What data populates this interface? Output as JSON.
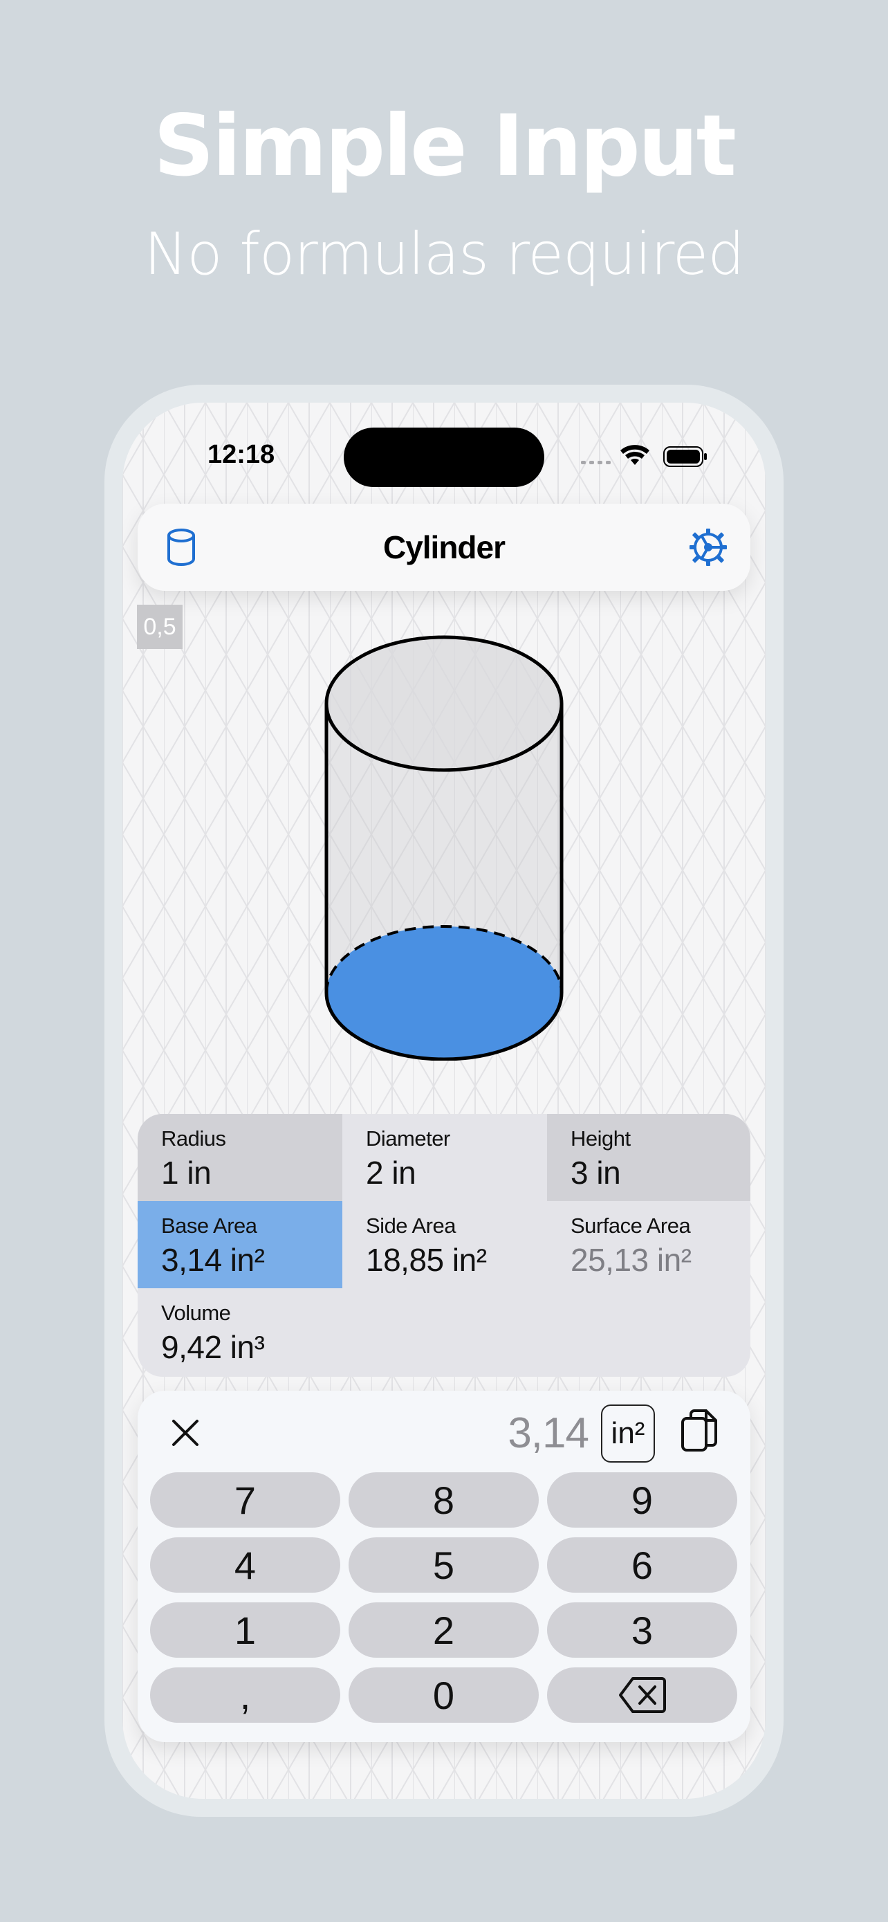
{
  "promo": {
    "headline": "Simple Input",
    "subline": "No formulas required"
  },
  "status_bar": {
    "time": "12:18",
    "icons": [
      "cellular-signal-icon",
      "wifi-icon",
      "battery-icon"
    ]
  },
  "nav": {
    "title": "Cylinder",
    "left_icon": "cylinder-shape-icon",
    "right_icon": "settings-gear-icon"
  },
  "scale_badge": "0,5",
  "figure": {
    "shape": "cylinder",
    "highlight": "base-area",
    "highlight_color": "#4a90e2"
  },
  "values": {
    "radius": {
      "label": "Radius",
      "value": "1 in"
    },
    "diameter": {
      "label": "Diameter",
      "value": "2 in"
    },
    "height": {
      "label": "Height",
      "value": "3 in"
    },
    "base_area": {
      "label": "Base Area",
      "value": "3,14 in²"
    },
    "side_area": {
      "label": "Side Area",
      "value": "18,85 in²"
    },
    "surface_area": {
      "label": "Surface Area",
      "value": "25,13 in²"
    },
    "volume": {
      "label": "Volume",
      "value": "9,42 in³"
    }
  },
  "keypad": {
    "value": "3,14",
    "unit": "in²",
    "keys": {
      "k7": "7",
      "k8": "8",
      "k9": "9",
      "k4": "4",
      "k5": "5",
      "k6": "6",
      "k1": "1",
      "k2": "2",
      "k3": "3",
      "comma": ",",
      "k0": "0"
    },
    "icons": [
      "close-icon",
      "copy-icon",
      "backspace-icon"
    ]
  },
  "colors": {
    "background": "#d1d8dd",
    "accent": "#1f6fd1",
    "selected_cell": "#7aaee9"
  }
}
